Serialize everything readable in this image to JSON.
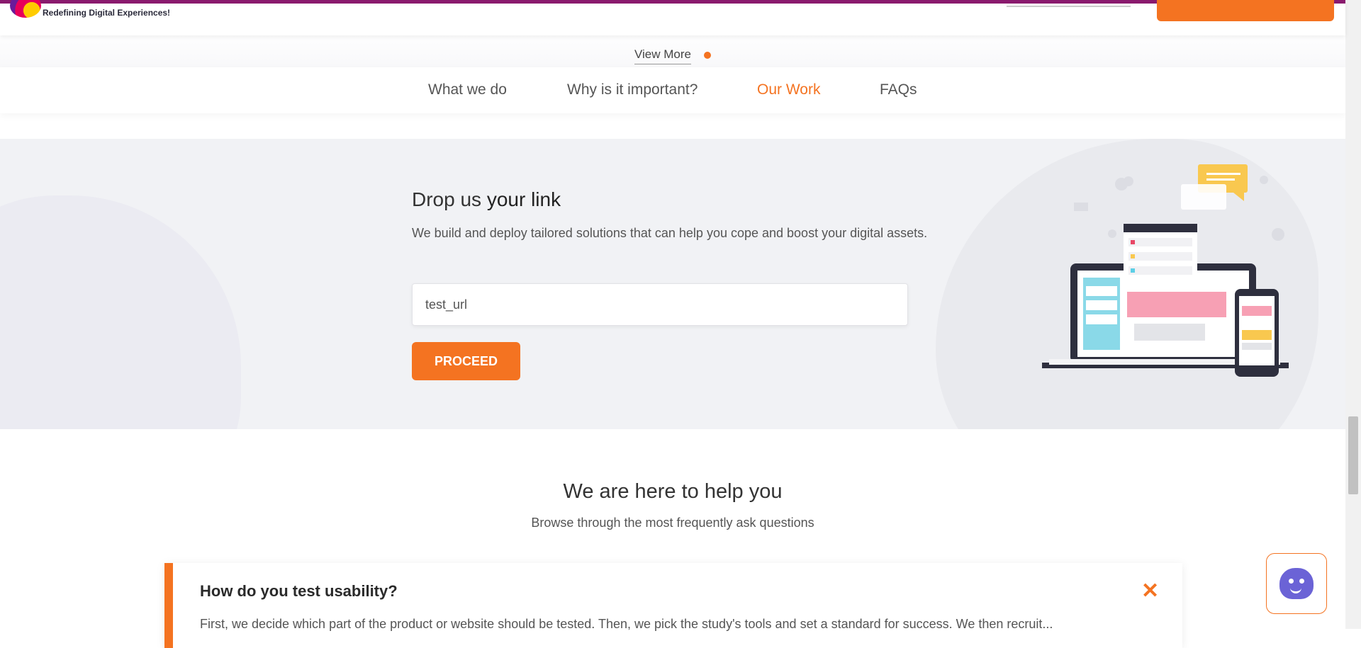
{
  "header": {
    "tagline": "Redefining Digital Experiences!"
  },
  "view_more": {
    "label": "View More"
  },
  "nav": {
    "tabs": [
      {
        "label": "What we do",
        "active": false
      },
      {
        "label": "Why is it important?",
        "active": false
      },
      {
        "label": "Our Work",
        "active": true
      },
      {
        "label": "FAQs",
        "active": false
      }
    ]
  },
  "link_section": {
    "title_light": "Drop us",
    "title_strong": "your link",
    "description": "We build and deploy tailored solutions that can help you cope and boost your digital assets.",
    "input_value": "test_url",
    "proceed_label": "PROCEED",
    "illustration_icon": "laptop-and-phone-illustration"
  },
  "help_section": {
    "title_light": "We are",
    "title_strong": "here to help you",
    "subtitle": "Browse through the most frequently ask questions"
  },
  "faq": {
    "question": "How do you test usability?",
    "close_icon": "close-icon",
    "answer_partial": "First, we decide which part of the product or website should be tested. Then, we pick the study's tools and set a standard for success. We then recruit... "
  },
  "chatbot": {
    "icon": "chatbot-icon"
  },
  "colors": {
    "accent": "#f47321",
    "brand_border": "#8a1a6e",
    "section_bg": "#f1f2f5",
    "bot": "#6b63d6"
  }
}
